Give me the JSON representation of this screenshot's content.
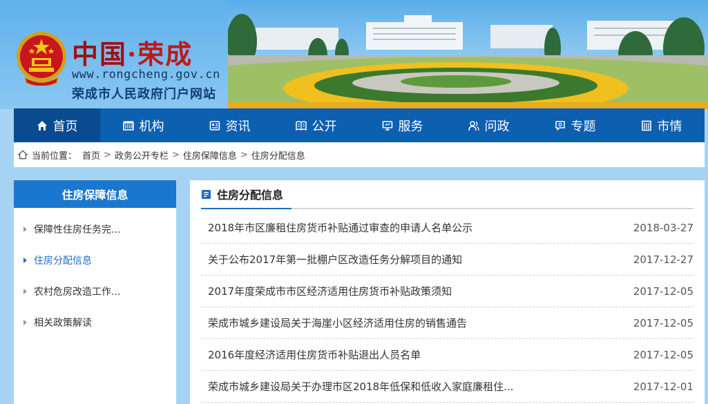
{
  "site": {
    "name_part1": "中国",
    "name_dot": "·",
    "name_part2": "荣成",
    "url": "www.rongcheng.gov.cn",
    "subtitle": "荣成市人民政府门户网站"
  },
  "nav": {
    "items": [
      {
        "label": "首页",
        "icon": "home-icon"
      },
      {
        "label": "机构",
        "icon": "building-icon"
      },
      {
        "label": "资讯",
        "icon": "news-icon"
      },
      {
        "label": "公开",
        "icon": "book-icon"
      },
      {
        "label": "服务",
        "icon": "monitor-icon"
      },
      {
        "label": "问政",
        "icon": "people-icon"
      },
      {
        "label": "专题",
        "icon": "chat-icon"
      },
      {
        "label": "市情",
        "icon": "city-icon"
      }
    ]
  },
  "breadcrumb": {
    "prefix": "当前位置：",
    "items": [
      "首页",
      "政务公开专栏",
      "住房保障信息",
      "住房分配信息"
    ]
  },
  "sidebar": {
    "title": "住房保障信息",
    "items": [
      {
        "label": "保障性住房任务完..."
      },
      {
        "label": "住房分配信息"
      },
      {
        "label": "农村危房改造工作..."
      },
      {
        "label": "相关政策解读"
      }
    ]
  },
  "main": {
    "title": "住房分配信息",
    "articles": [
      {
        "title": "2018年市区廉租住房货币补贴通过审查的申请人名单公示",
        "date": "2018-03-27"
      },
      {
        "title": "关于公布2017年第一批棚户区改造任务分解项目的通知",
        "date": "2017-12-27"
      },
      {
        "title": "2017年度荣成市市区经济适用住房货币补贴政策须知",
        "date": "2017-12-05"
      },
      {
        "title": "荣成市城乡建设局关于海崖小区经济适用住房的销售通告",
        "date": "2017-12-05"
      },
      {
        "title": "2016年度经济适用住房货币补贴退出人员名单",
        "date": "2017-12-05"
      },
      {
        "title": "荣成市城乡建设局关于办理市区2018年低保和低收入家庭廉租住...",
        "date": "2017-12-01"
      }
    ]
  },
  "colors": {
    "nav_bg": "#0d5fb0",
    "nav_active": "#0a4a8e",
    "accent": "#1a6fc4",
    "page_bg": "#a6d3f3",
    "brand_red": "#c11818"
  }
}
